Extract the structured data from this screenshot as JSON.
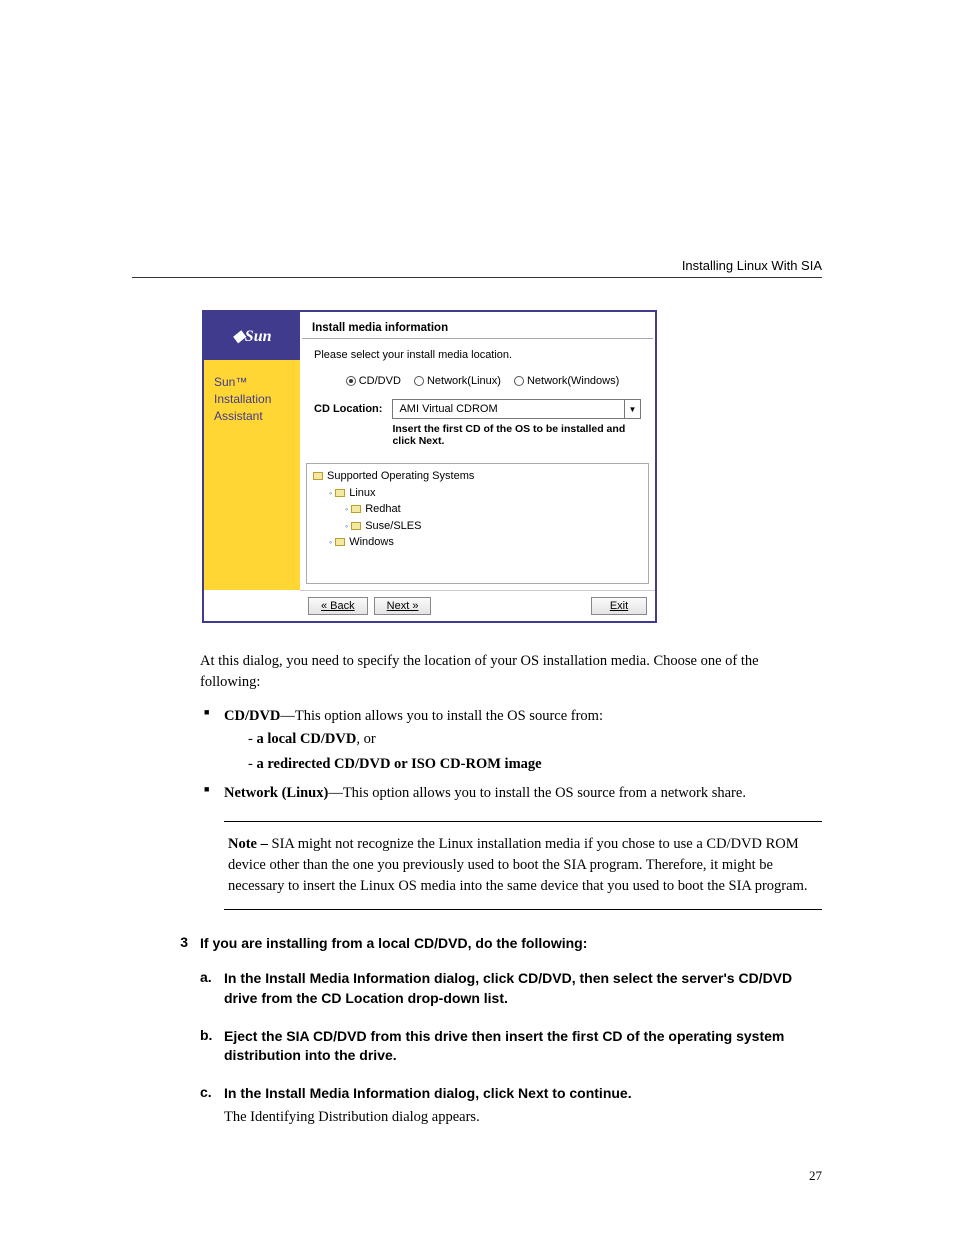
{
  "header": {
    "title": "Installing Linux With SIA"
  },
  "dialog": {
    "logo": "◆Sun",
    "sidebar_lines": [
      "Sun™",
      "Installation",
      "Assistant"
    ],
    "title": "Install media information",
    "subtitle": "Please select your install media location.",
    "radios": {
      "opt1": "CD/DVD",
      "opt2": "Network(Linux)",
      "opt3": "Network(Windows)"
    },
    "cd_label": "CD Location:",
    "cd_value": "AMI Virtual CDROM",
    "cd_helper": "Insert the first CD of the OS to be installed and click Next.",
    "tree": {
      "root": "Supported Operating Systems",
      "linux": "Linux",
      "redhat": "Redhat",
      "suse": "Suse/SLES",
      "windows": "Windows"
    },
    "buttons": {
      "back": "« Back",
      "next": "Next »",
      "exit": "Exit"
    }
  },
  "body": {
    "intro": "At this dialog, you need to specify the location of your OS installation media. Choose one of the following:",
    "li1_lead": "CD/DVD",
    "li1_rest": "—This option allows you to install the OS source from:",
    "li1_sub1_dash": "- ",
    "li1_sub1_bold": "a local CD/DVD",
    "li1_sub1_tail": ", or",
    "li1_sub2_dash": "- ",
    "li1_sub2_bold": "a redirected CD/DVD or ISO CD-ROM image",
    "li2_lead": "Network (Linux)",
    "li2_rest": "—This option allows you to install the OS source from a network share.",
    "note_lead": "Note – ",
    "note_body": "SIA might not recognize the Linux installation media if you chose to use a CD/DVD ROM device other than the one you previously used to boot the SIA program. Therefore, it might be necessary to insert the Linux OS media into the same device that you used to boot the SIA program.",
    "step3_num": "3",
    "step3": "If you are installing from a local CD/DVD, do the following:",
    "sa_l": "a.",
    "sa": "In the Install Media Information dialog, click CD/DVD, then select the server's CD/DVD drive from the CD Location drop-down list.",
    "sb_l": "b.",
    "sb": "Eject the SIA CD/DVD from this drive then insert the first CD of the operating system distribution into the drive.",
    "sc_l": "c.",
    "sc": "In the Install Media Information dialog, click Next to continue.",
    "sc_follow": "The Identifying Distribution dialog appears.",
    "page_num": "27"
  }
}
